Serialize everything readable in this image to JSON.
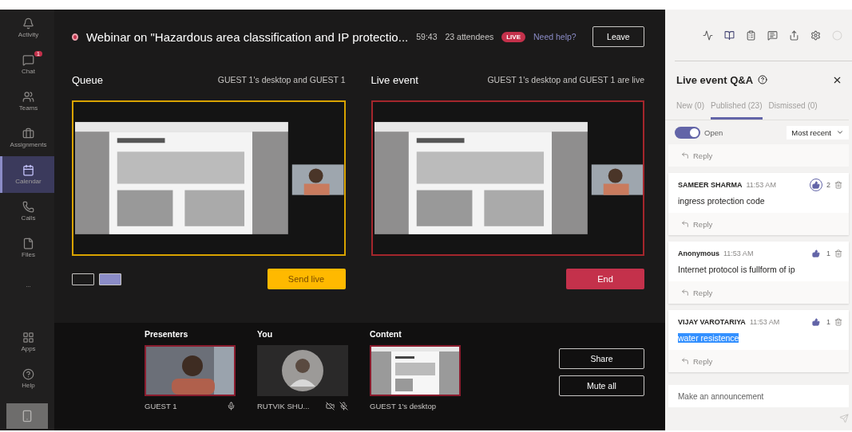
{
  "sidebar": {
    "items": [
      {
        "label": "Activity",
        "selected": false
      },
      {
        "label": "Chat",
        "selected": false,
        "badge": "1"
      },
      {
        "label": "Teams",
        "selected": false
      },
      {
        "label": "Assignments",
        "selected": false
      },
      {
        "label": "Calendar",
        "selected": true
      },
      {
        "label": "Calls",
        "selected": false
      },
      {
        "label": "Files",
        "selected": false
      },
      {
        "label": "...",
        "selected": false
      }
    ],
    "bottom_items": [
      {
        "label": "Apps"
      },
      {
        "label": "Help"
      }
    ]
  },
  "header": {
    "title": "Webinar on \"Hazardous area classification and IP protectio...",
    "timer": "59:43",
    "attendees": "23 attendees",
    "live_badge": "LIVE",
    "help_link": "Need help?",
    "leave_button": "Leave"
  },
  "queue": {
    "title": "Queue",
    "caption": "GUEST 1's desktop and GUEST 1",
    "layouts": [
      {
        "selected": false
      },
      {
        "selected": true
      }
    ],
    "button": "Send live"
  },
  "live": {
    "title": "Live event",
    "caption": "GUEST 1's desktop and GUEST 1 are live",
    "button": "End"
  },
  "sources": [
    {
      "heading": "Presenters",
      "name": "GUEST 1",
      "kind": "video",
      "selected": true
    },
    {
      "heading": "You",
      "name": "RUTVIK SHU...",
      "kind": "avatar",
      "selected": false
    },
    {
      "heading": "Content",
      "name": "GUEST 1's desktop",
      "kind": "screen",
      "selected": true
    }
  ],
  "source_buttons": [
    "Share",
    "Mute all"
  ],
  "panel": {
    "title": "Live event Q&A",
    "tabs": [
      {
        "label": "New (0)",
        "selected": false
      },
      {
        "label": "Published (23)",
        "selected": true
      },
      {
        "label": "Dismissed (0)",
        "selected": false
      }
    ],
    "open_toggle": {
      "label": "Open",
      "on": true
    },
    "sort": "Most recent",
    "top_reply": "Reply",
    "questions": [
      {
        "author": "SAMEER SHARMA",
        "time": "11:53 AM",
        "text": "ingress protection code",
        "likes": "2",
        "focused": true,
        "text_selected": false,
        "reply": "Reply"
      },
      {
        "author": "Anonymous",
        "time": "11:53 AM",
        "text": "Internet protocol is fullform of ip",
        "likes": "1",
        "focused": false,
        "text_selected": false,
        "reply": "Reply"
      },
      {
        "author": "VIJAY VAROTARIYA",
        "time": "11:53 AM",
        "text": "water resistence",
        "likes": "1",
        "focused": false,
        "text_selected": true,
        "reply": "Reply"
      }
    ],
    "announcement_placeholder": "Make an announcement"
  }
}
